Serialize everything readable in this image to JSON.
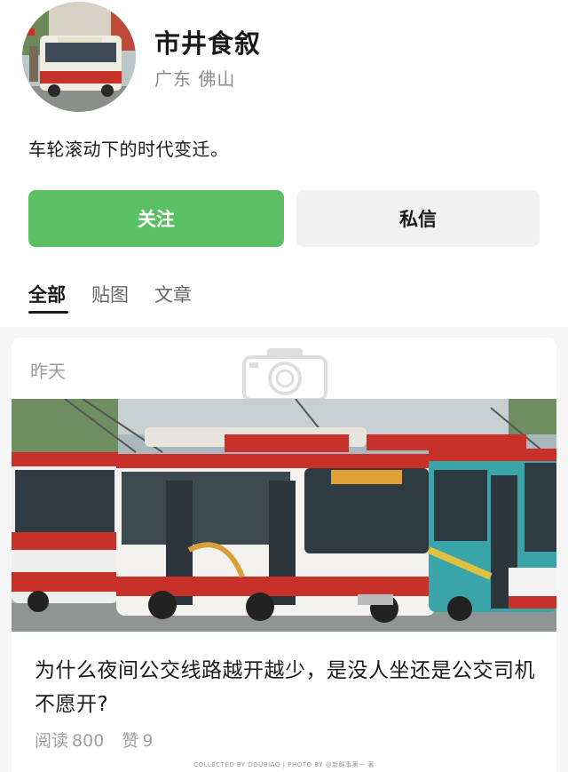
{
  "profile": {
    "name": "市井食叙",
    "location": "广东 佛山",
    "bio": "车轮滚动下的时代变迁。"
  },
  "actions": {
    "follow_label": "关注",
    "message_label": "私信",
    "follow_color": "#5ac063"
  },
  "tabs": [
    {
      "label": "全部",
      "active": true
    },
    {
      "label": "贴图",
      "active": false
    },
    {
      "label": "文章",
      "active": false
    }
  ],
  "feed": {
    "posts": [
      {
        "date": "昨天",
        "image_icon": "bus-photo",
        "title": "为什么夜间公交线路越开越少，是没人坐还是公交司机不愿开?",
        "reads_label": "阅读",
        "reads": "800",
        "likes_label": "赞",
        "likes": "9"
      }
    ]
  },
  "footer": {
    "credit": "COLLECTED BY DOUBIAO | PHOTO BY @新鲜事第一 著"
  }
}
